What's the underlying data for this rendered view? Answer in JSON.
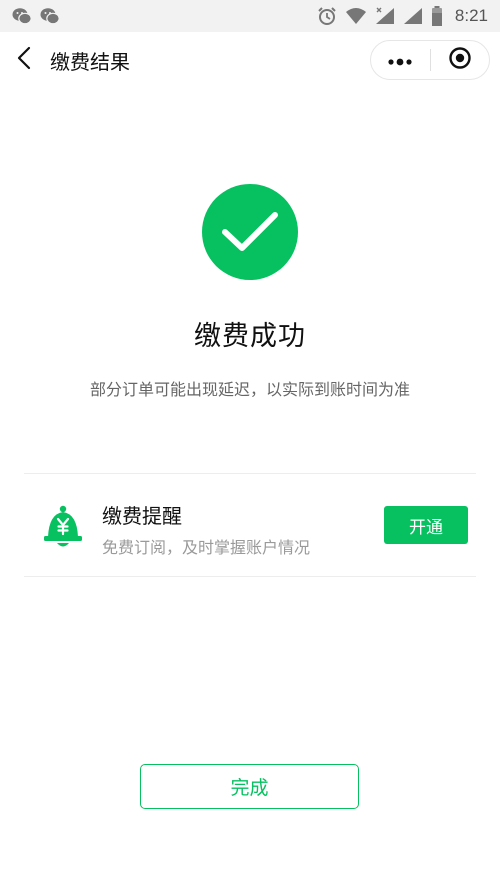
{
  "status_bar": {
    "time": "8:21",
    "left_icons": [
      "wechat-icon",
      "wechat-icon"
    ],
    "right_icons": [
      "alarm-icon",
      "wifi-icon",
      "signal-icon",
      "signal-icon",
      "battery-icon"
    ]
  },
  "nav": {
    "title": "缴费结果",
    "back_icon": "chevron-left-icon",
    "capsule": {
      "more_icon": "more-dots-icon",
      "close_icon": "target-close-icon"
    }
  },
  "result": {
    "icon": "checkmark-icon",
    "title": "缴费成功",
    "description": "部分订单可能出现延迟，以实际到账时间为准"
  },
  "reminder": {
    "icon": "bell-yuan-icon",
    "title": "缴费提醒",
    "description": "免费订阅，及时掌握账户情况",
    "button_label": "开通"
  },
  "footer": {
    "done_label": "完成"
  },
  "colors": {
    "accent": "#07c160",
    "text_primary": "#111111",
    "text_secondary": "#666666",
    "text_muted": "#9a9a9a"
  }
}
